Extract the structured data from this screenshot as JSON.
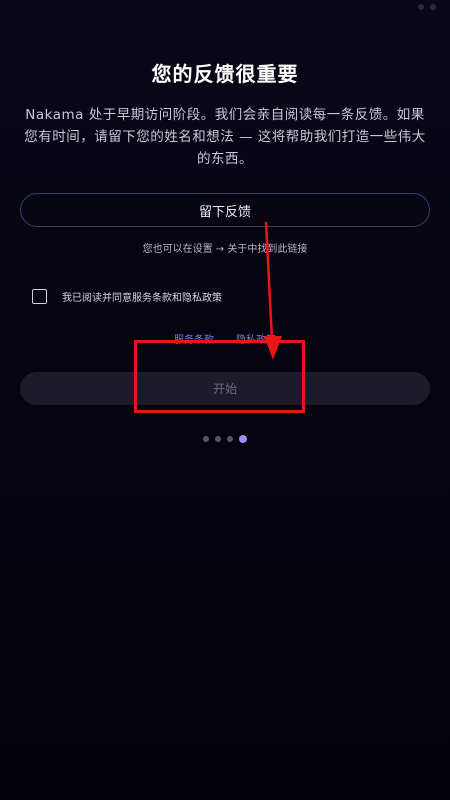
{
  "onboarding": {
    "title": "您的反馈很重要",
    "description": "Nakama 处于早期访问阶段。我们会亲自阅读每一条反馈。如果您有时间，请留下您的姓名和想法 — 这将帮助我们打造一些伟大的东西。",
    "feedback_button_label": "留下反馈",
    "hint": "您也可以在设置 → 关于中找到此链接",
    "consent_label": "我已阅读并同意服务条款和隐私政策",
    "consent_checked": false,
    "links": {
      "terms": "服务条款",
      "privacy": "隐私政策"
    },
    "start_button_label": "开始",
    "start_button_enabled": false,
    "pager": {
      "total": 4,
      "active_index": 3
    }
  },
  "annotation": {
    "highlight_color": "#e81616",
    "arrow_color": "#e81616"
  },
  "colors": {
    "background": "#05040f",
    "accent": "#a48cf2",
    "link": "#8d74e8"
  }
}
